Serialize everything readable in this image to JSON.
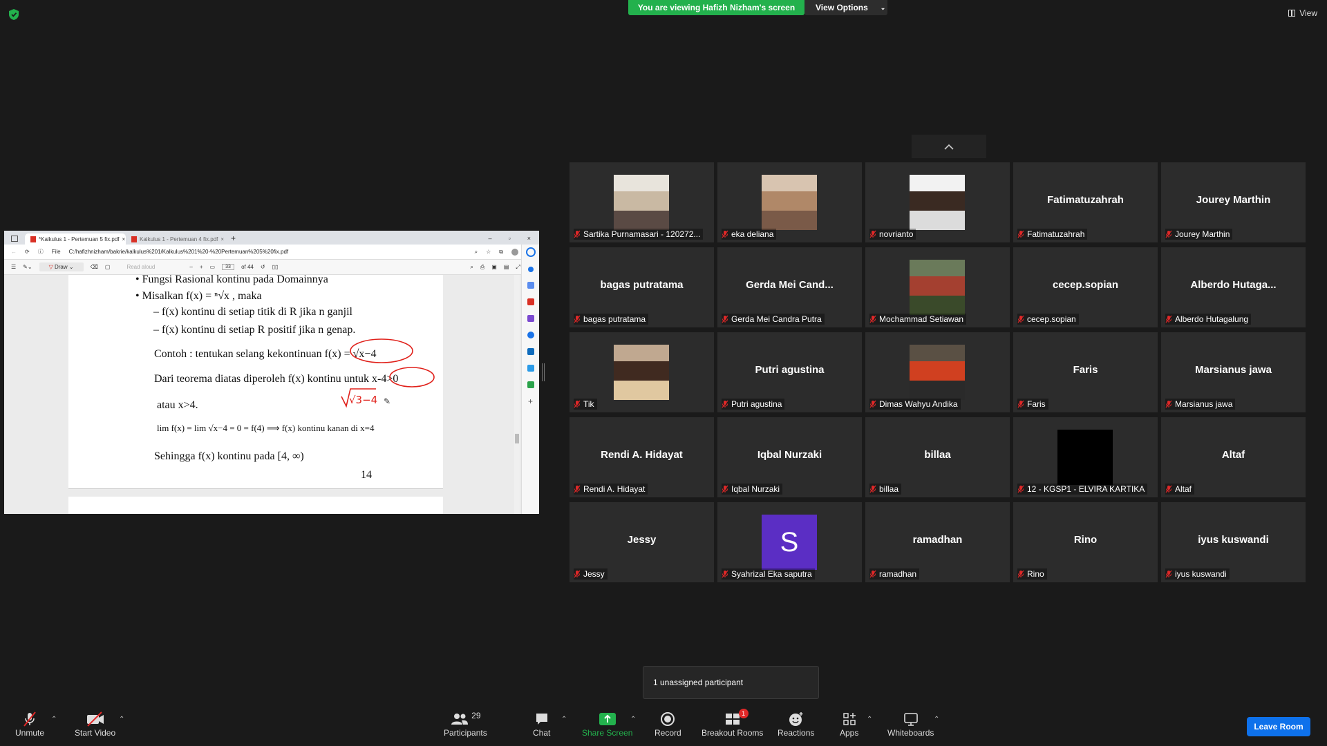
{
  "top": {
    "viewing_banner": "You are viewing Hafizh Nizham's screen",
    "view_options": "View Options",
    "view_btn": "View"
  },
  "browser": {
    "tabs": [
      "*Kalkulus 1 - Pertemuan 5 fix.pdf",
      "Kalkulus 1 - Pertemuan 4 fix.pdf"
    ],
    "address_prefix": "File",
    "url": "C:/hafizhnizham/bakrie/kalkulus%201/Kalkulus%201%20-%20Pertemuan%205%20fix.pdf",
    "draw_label": "Draw",
    "read_aloud": "Read aloud",
    "page_current": "33",
    "page_total": "of 44"
  },
  "pdf": {
    "lines": [
      "•     Fungsi Rasional kontinu pada Domainnya",
      "•     Misalkan  f(x) = ⁿ√x  , maka",
      "–     f(x) kontinu di setiap titik di R jika n ganjil",
      "–     f(x) kontinu di setiap R positif jika n genap.",
      "Contoh : tentukan selang kekontinuan   f(x) = √x−4",
      "Dari teorema diatas diperoleh f(x) kontinu untuk x-4>0",
      "atau x>4.",
      "lim f(x) = lim √x−4 = 0 = f(4)  ⟹  f(x) kontinu kanan di x=4",
      "Sehingga f(x) kontinu pada [4, ∞)"
    ],
    "annotation": "√3−4",
    "page_number": "14"
  },
  "participants": [
    {
      "big": "",
      "name": "Sartika Purnamasari - 120272...",
      "avatar": "photo"
    },
    {
      "big": "",
      "name": "eka deliana",
      "avatar": "photo"
    },
    {
      "big": "",
      "name": "novrianto",
      "avatar": "photo"
    },
    {
      "big": "Fatimatuzahrah",
      "name": "Fatimatuzahrah",
      "avatar": "none"
    },
    {
      "big": "Jourey Marthin",
      "name": "Jourey Marthin",
      "avatar": "none"
    },
    {
      "big": "bagas putratama",
      "name": "bagas putratama",
      "avatar": "none"
    },
    {
      "big": "Gerda  Mei  Cand...",
      "name": "Gerda Mei Candra Putra",
      "avatar": "none"
    },
    {
      "big": "",
      "name": "Mochammad Setiawan",
      "avatar": "photo"
    },
    {
      "big": "cecep.sopian",
      "name": "cecep.sopian",
      "avatar": "none"
    },
    {
      "big": "Alberdo  Hutaga...",
      "name": "Alberdo Hutagalung",
      "avatar": "none"
    },
    {
      "big": "",
      "name": "Tik",
      "avatar": "photo"
    },
    {
      "big": "Putri agustina",
      "name": "Putri agustina",
      "avatar": "none"
    },
    {
      "big": "",
      "name": "Dimas Wahyu Andika",
      "avatar": "photo"
    },
    {
      "big": "Faris",
      "name": "Faris",
      "avatar": "none"
    },
    {
      "big": "Marsianus jawa",
      "name": "Marsianus jawa",
      "avatar": "none"
    },
    {
      "big": "Rendi A. Hidayat",
      "name": "Rendi A. Hidayat",
      "avatar": "none"
    },
    {
      "big": "Iqbal Nurzaki",
      "name": "Iqbal Nurzaki",
      "avatar": "none"
    },
    {
      "big": "billaa",
      "name": "billaa",
      "avatar": "none"
    },
    {
      "big": "",
      "name": "12 - KGSP1 - ELVIRA KARTIKA",
      "avatar": "black"
    },
    {
      "big": "Altaf",
      "name": "Altaf",
      "avatar": "none"
    },
    {
      "big": "Jessy",
      "name": "Jessy",
      "avatar": "none"
    },
    {
      "big": "",
      "name": "Syahrizal Eka saputra",
      "avatar": "letter",
      "letter": "S"
    },
    {
      "big": "ramadhan",
      "name": "ramadhan",
      "avatar": "none"
    },
    {
      "big": "Rino",
      "name": "Rino",
      "avatar": "none"
    },
    {
      "big": "iyus kuswandi",
      "name": "iyus kuswandi",
      "avatar": "none"
    }
  ],
  "toast": "1 unassigned participant",
  "toolbar": {
    "unmute": "Unmute",
    "start_video": "Start Video",
    "participants": "Participants",
    "participants_count": "29",
    "chat": "Chat",
    "share_screen": "Share Screen",
    "record": "Record",
    "breakout_rooms": "Breakout Rooms",
    "breakout_badge": "1",
    "reactions": "Reactions",
    "apps": "Apps",
    "whiteboards": "Whiteboards",
    "leave_room": "Leave Room"
  },
  "colors": {
    "share_green": "#23b14d",
    "leave_blue": "#0e71eb",
    "mute_red": "#e02828",
    "letter_avatar": "#5b2ec4"
  }
}
